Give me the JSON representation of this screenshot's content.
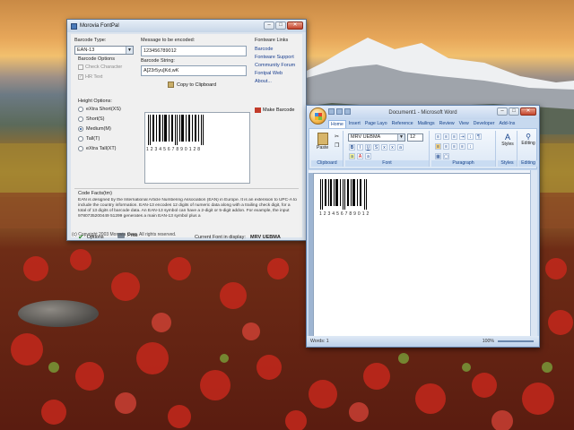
{
  "fontpal": {
    "title": "Morovia FontPal",
    "barcode_type_label": "Barcode Type:",
    "barcode_type_value": "EAN-13",
    "barcode_options_label": "Barcode Options",
    "check_character_label": "Check Character",
    "hr_text_label": "HR Text",
    "message_label": "Message to be encoded:",
    "message_value": "123456789012",
    "barcode_string_label": "Barcode String:",
    "barcode_string_value": "A[23r5yu]Kd,wK",
    "copy_button": "Copy to Clipboard",
    "height_options_label": "Height Options:",
    "height_options": [
      "eXtra Short(XS)",
      "Short(S)",
      "Medium(M)",
      "Tall(T)",
      "eXtra Tall(XT)"
    ],
    "height_selected_index": 2,
    "links_label": "Fontware Links",
    "links": [
      "Barcode",
      "Fontware Support",
      "Community Forum",
      "Fontpal Web",
      "About..."
    ],
    "make_barcode_button": "Make Barcode",
    "barcode_digits": "1 2 3 4 5 6 7 8 9 0 1 2 8",
    "code_facts_label": "Code Facts(tm)",
    "code_facts_text": "EAN is designed by the International Article Numbering Association (EAN) in Europe. It is an extension to UPC-A to include the country information. EAN-13 encodes 12 digits of numeric data along with a trailing check digit, for a total of 13 digits of barcode data. An EAN-13 symbol can have a 2-digit or 5-digit addon. For example, the input 9780735200449 51299 generates a main EAN-13 symbol plus a",
    "options_button": "Options",
    "print_button": "Print",
    "current_font_label": "Current Font in display:",
    "current_font_value": "MRV UEBMA",
    "copyright": "(c) Copyright 2003 Morovia Corp. All rights reserved."
  },
  "word": {
    "title": "Document1 - Microsoft Word",
    "tabs": [
      "Home",
      "Insert",
      "Page Layo",
      "Reference",
      "Mailings",
      "Review",
      "View",
      "Developer",
      "Add-Ins"
    ],
    "font_name": "MRV UEBMA",
    "font_size": "12",
    "groups": [
      "Clipboard",
      "Font",
      "Paragraph",
      "Styles",
      "Editing"
    ],
    "paste_label": "Paste",
    "styles_label": "Styles",
    "editing_label": "Editing",
    "barcode_digits": "1 2 3 4 5 6 7 8 9 0 1 2",
    "status_page": "Words: 1",
    "zoom": "100%"
  }
}
